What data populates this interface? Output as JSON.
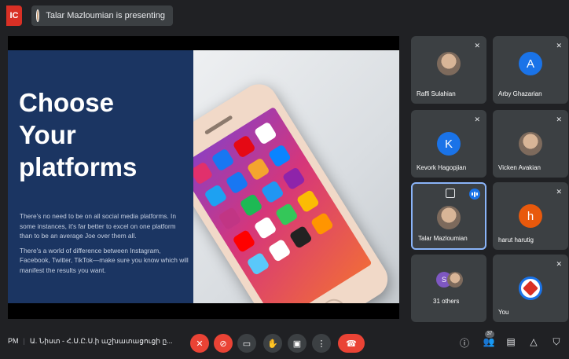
{
  "topbar": {
    "rec_label": "IC",
    "presenting_text": "Talar Mazloumian is presenting"
  },
  "slide": {
    "title_lines": [
      "Choose",
      "Your",
      "platforms"
    ],
    "paragraph1": "There's no need to be on all social media platforms. In some instances, it's far better to excel on one platform than to be an average Joe over them all.",
    "paragraph2": "There's a world of difference between Instagram, Facebook, Twitter, TikTok—make sure you know which will manifest the results you want."
  },
  "participants": [
    {
      "name": "Raffi Sulahian",
      "avatar_type": "photo",
      "muted": true
    },
    {
      "name": "Arby Ghazarian",
      "avatar_letter": "A",
      "avatar_color": "#1a73e8",
      "muted": true
    },
    {
      "name": "Kevork Hagopjian",
      "avatar_letter": "K",
      "avatar_color": "#1a73e8",
      "muted": true
    },
    {
      "name": "Vicken Avakian",
      "avatar_type": "photo",
      "muted": true
    },
    {
      "name": "Talar Mazloumian",
      "avatar_type": "photo",
      "speaking": true,
      "active": true
    },
    {
      "name": "harut harutig",
      "avatar_letter": "h",
      "avatar_color": "#e8590c",
      "muted": true
    },
    {
      "name": "31 others",
      "avatar_letter": "S",
      "avatar_color": "#7e57c2"
    },
    {
      "name": "You",
      "avatar_type": "logo",
      "muted": true
    }
  ],
  "bottombar": {
    "time_fragment": "PM",
    "meeting_title": "Ա. Նիստ - Հ.Ս.Ը.Ս.ի աշխատացուցի ը...",
    "participants_count": "37"
  },
  "icons": {
    "mic_off": "mic-off-icon",
    "cam_off": "camera-off-icon",
    "captions": "captions-icon",
    "raise_hand": "raise-hand-icon",
    "present": "present-icon",
    "more": "more-options-icon",
    "end_call": "end-call-icon",
    "info": "info-icon",
    "people": "people-icon",
    "chat": "chat-icon",
    "activities": "activities-icon",
    "host_controls": "host-controls-icon"
  },
  "colors": {
    "background": "#202124",
    "tile": "#3c4043",
    "danger": "#ea4335",
    "accent": "#1a73e8",
    "slide_blue": "#1b3562"
  }
}
